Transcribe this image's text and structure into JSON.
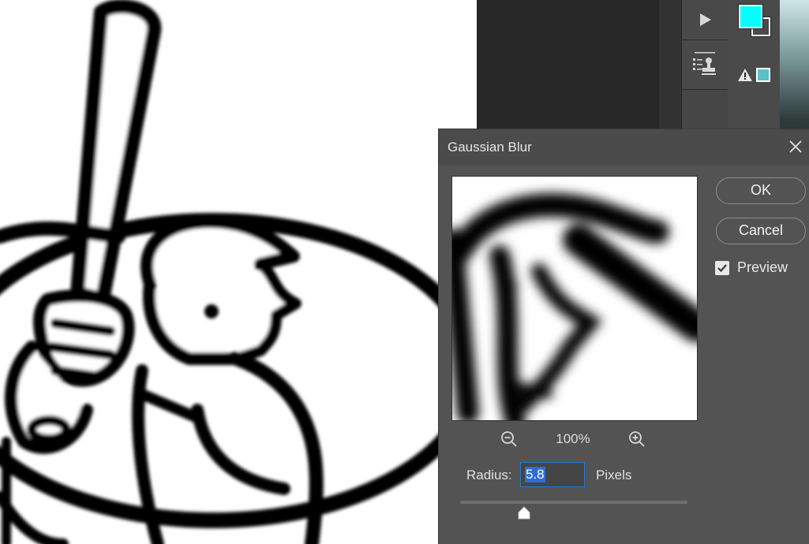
{
  "dialog": {
    "title": "Gaussian Blur",
    "ok_label": "OK",
    "cancel_label": "Cancel",
    "preview_label": "Preview",
    "preview_checked": true,
    "zoom_level": "100%",
    "radius_label": "Radius:",
    "radius_value": "5.8",
    "radius_unit": "Pixels",
    "radius_slider_fraction": 0.28
  },
  "panel": {
    "foreground_color": "#00ffff",
    "background_color": "#ffffff",
    "web_safe_swatch": "#5bbfc8"
  },
  "icons": [
    "play-icon",
    "stamp-icon",
    "close-icon",
    "zoom-out-icon",
    "zoom-in-icon",
    "checkmark-icon",
    "warning-icon"
  ]
}
